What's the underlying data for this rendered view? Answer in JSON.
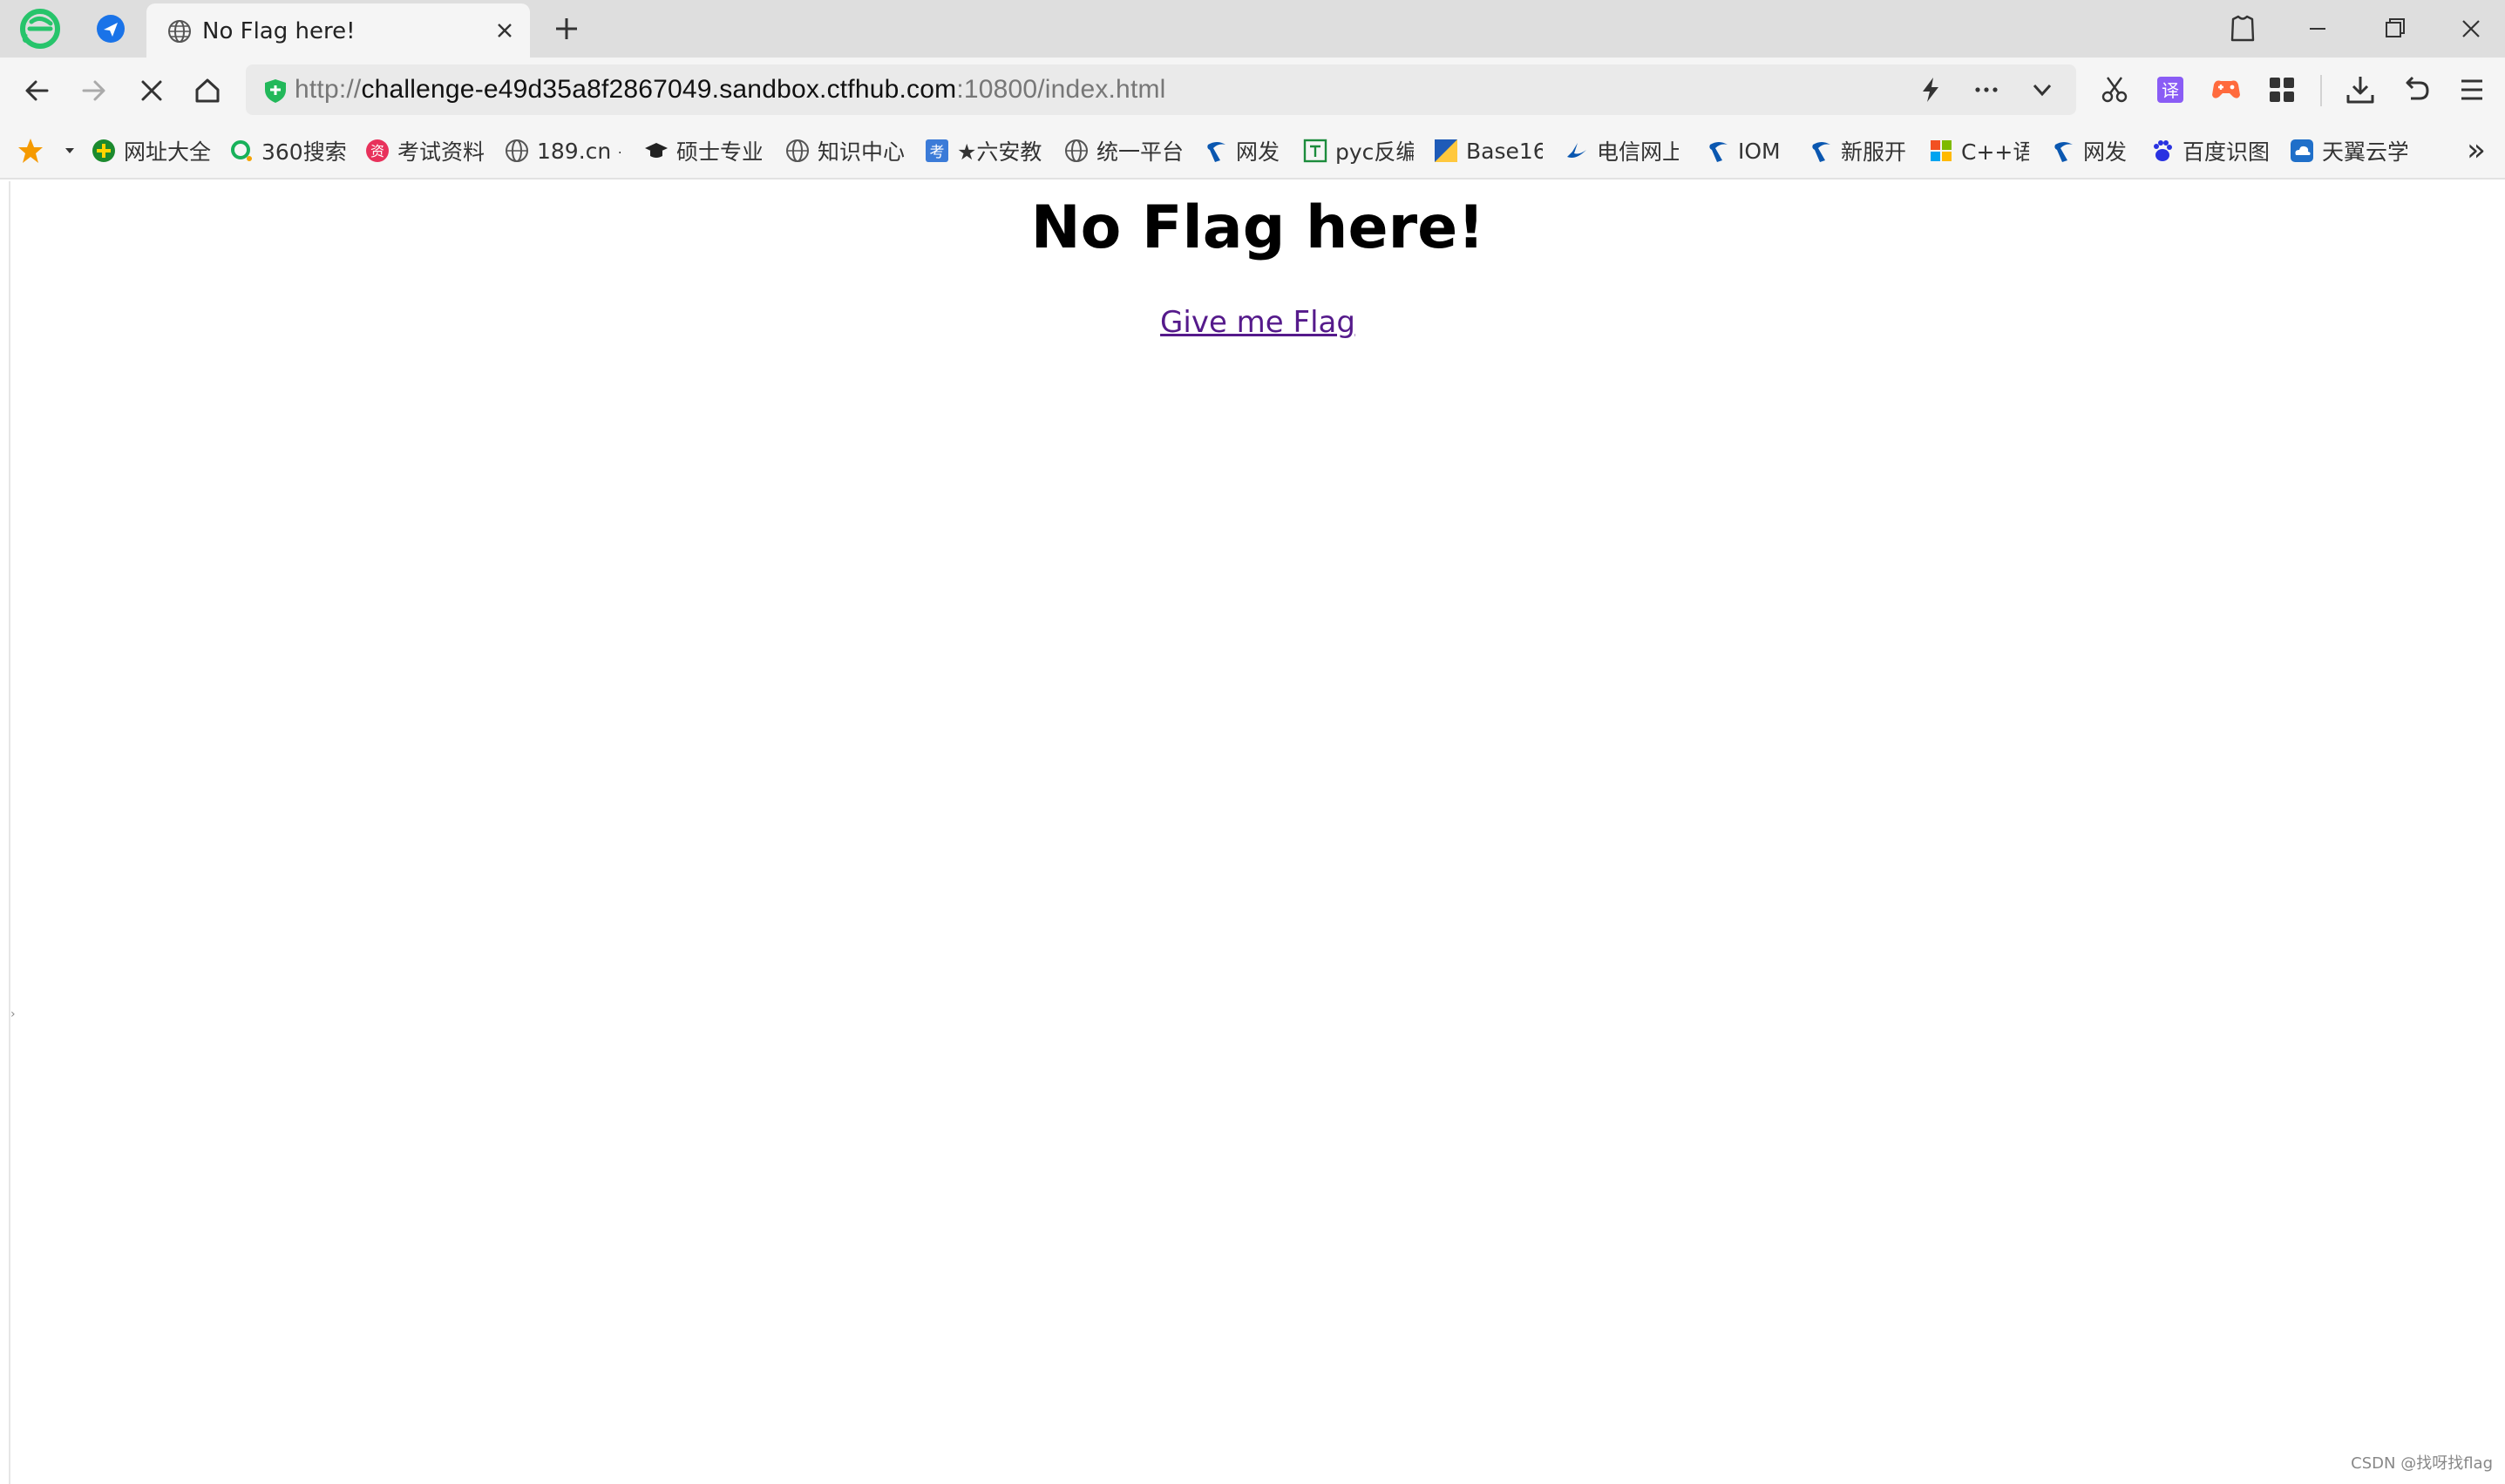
{
  "tabbar": {
    "active_tab_title": "No Flag here!"
  },
  "navbar": {
    "url_protocol": "http://",
    "url_host": "challenge-e49d35a8f2867049.sandbox.ctfhub.com",
    "url_rest": ":10800/index.html"
  },
  "bookmarks": {
    "items": [
      {
        "label": "网址大全",
        "icon": "360-nav-icon"
      },
      {
        "label": "360搜索",
        "icon": "360-search-icon"
      },
      {
        "label": "考试资料",
        "icon": "exam-icon"
      },
      {
        "label": "189.cn -",
        "icon": "globe-icon"
      },
      {
        "label": "硕士专业",
        "icon": "graduation-cap-icon"
      },
      {
        "label": "知识中心",
        "icon": "globe-icon"
      },
      {
        "label": "★六安教",
        "icon": "kao-icon"
      },
      {
        "label": "统一平台",
        "icon": "globe-icon"
      },
      {
        "label": "网发",
        "icon": "telecom-icon"
      },
      {
        "label": "pyc反编",
        "icon": "tool-icon"
      },
      {
        "label": "Base16",
        "icon": "base-icon"
      },
      {
        "label": "电信网上",
        "icon": "telecom-bird-icon"
      },
      {
        "label": "IOM",
        "icon": "telecom-icon"
      },
      {
        "label": "新服开",
        "icon": "telecom-icon"
      },
      {
        "label": "C++语",
        "icon": "windows-icon"
      },
      {
        "label": "网发",
        "icon": "telecom-icon"
      },
      {
        "label": "百度识图",
        "icon": "baidu-icon"
      },
      {
        "label": "天翼云学",
        "icon": "cloud-icon"
      }
    ],
    "overflow": "»"
  },
  "page": {
    "heading": "No Flag here!",
    "link_text": "Give me Flag"
  },
  "watermark": "CSDN @找呀找flag",
  "colors": {
    "link_visited": "#551a8b",
    "tab_strip": "#dedede",
    "toolbar": "#f5f5f5",
    "browser_logo": "#2ecc71"
  }
}
